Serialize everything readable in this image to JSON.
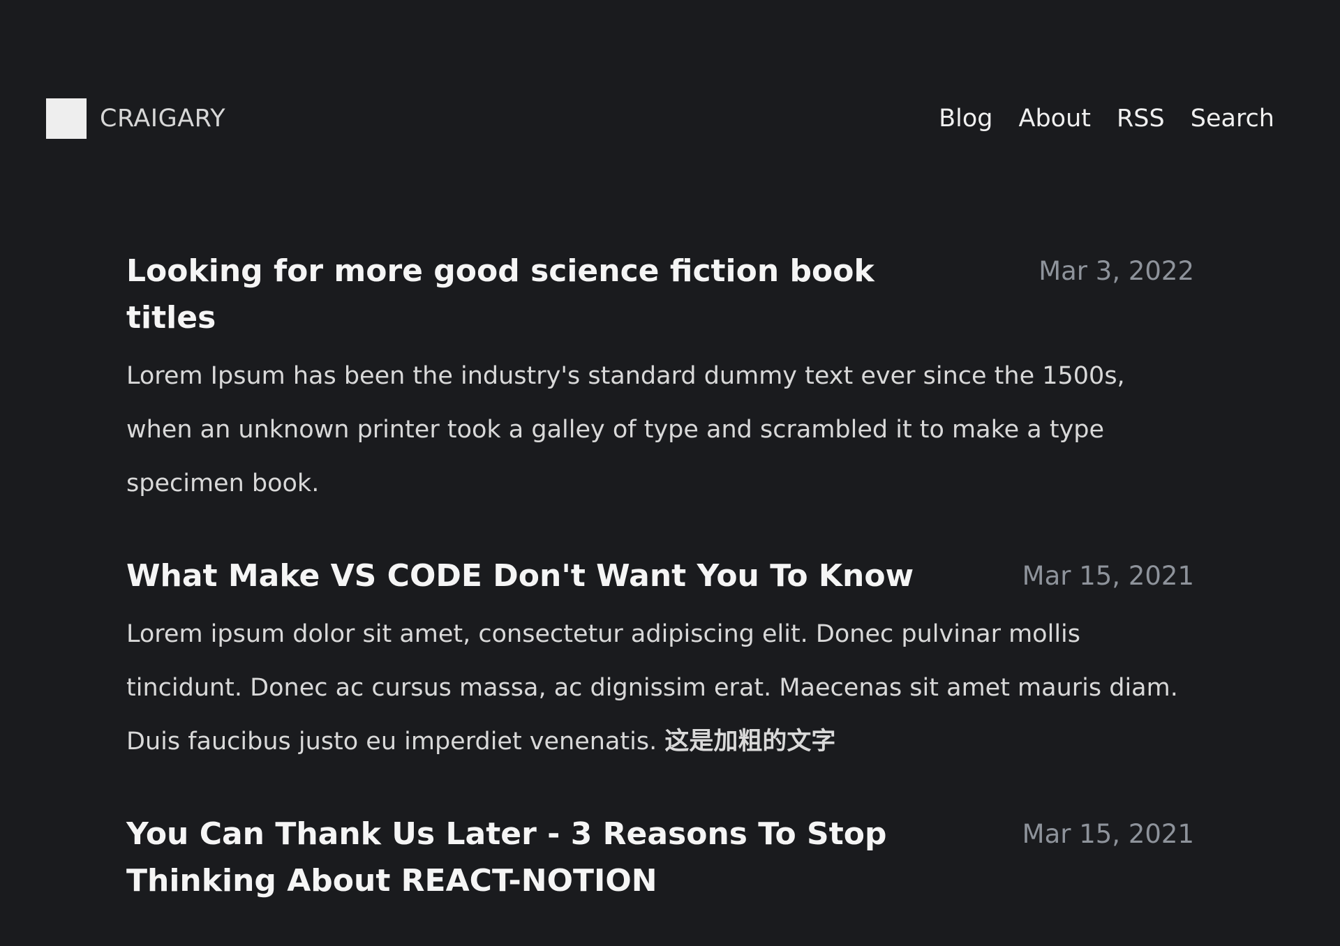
{
  "header": {
    "brand": "CRAIGARY",
    "nav": [
      "Blog",
      "About",
      "RSS",
      "Search"
    ]
  },
  "posts": [
    {
      "title": "Looking for more good science fiction book titles",
      "date": "Mar 3, 2022",
      "summary": "Lorem Ipsum has been the industry's standard dummy text ever since the 1500s, when an unknown printer took a galley of type and scrambled it to make a type specimen book."
    },
    {
      "title": "What Make VS CODE Don't Want You To Know",
      "date": "Mar 15, 2021",
      "summary": "Lorem ipsum dolor sit amet, consectetur adipiscing elit. Donec pulvinar mollis tincidunt. Donec ac cursus massa, ac dignissim erat. Maecenas sit amet mauris diam. Duis faucibus justo eu imperdiet venenatis.",
      "summary_bold": "这是加粗的文字"
    },
    {
      "title": "You Can Thank Us Later - 3 Reasons To Stop Thinking About REACT-NOTION",
      "date": "Mar 15, 2021"
    }
  ],
  "colors": {
    "background": "#1a1b1e",
    "title": "#f5f5f5",
    "date": "#8e939b",
    "body": "#d9d9d9"
  }
}
